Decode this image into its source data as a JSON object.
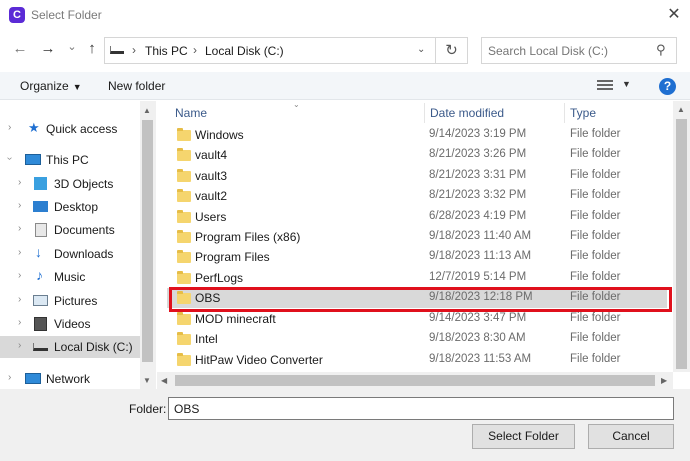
{
  "window": {
    "title": "Select Folder",
    "app_icon_letter": "C"
  },
  "nav": {
    "back": "←",
    "forward": "→",
    "recent": "⌄",
    "up": "↑",
    "breadcrumbs": [
      "This PC",
      "Local Disk (C:)"
    ],
    "separator": "›",
    "refresh": "↻"
  },
  "search": {
    "placeholder": "Search Local Disk (C:)"
  },
  "toolbar": {
    "organize": "Organize",
    "new_folder": "New folder",
    "help": "?"
  },
  "sidebar": {
    "items": [
      {
        "label": "Quick access",
        "icon": "star-icon"
      },
      {
        "label": "This PC",
        "icon": "pc-icon"
      },
      {
        "label": "3D Objects",
        "icon": "cube-icon"
      },
      {
        "label": "Desktop",
        "icon": "desktop-icon"
      },
      {
        "label": "Documents",
        "icon": "documents-icon"
      },
      {
        "label": "Downloads",
        "icon": "download-icon"
      },
      {
        "label": "Music",
        "icon": "music-icon"
      },
      {
        "label": "Pictures",
        "icon": "pictures-icon"
      },
      {
        "label": "Videos",
        "icon": "videos-icon"
      },
      {
        "label": "Local Disk (C:)",
        "icon": "drive-icon"
      },
      {
        "label": "Network",
        "icon": "network-icon"
      }
    ],
    "selected": "Local Disk (C:)"
  },
  "columns": {
    "name": "Name",
    "date": "Date modified",
    "type": "Type"
  },
  "files": [
    {
      "name": "Windows",
      "date": "9/14/2023 3:19 PM",
      "type": "File folder"
    },
    {
      "name": "vault4",
      "date": "8/21/2023 3:26 PM",
      "type": "File folder"
    },
    {
      "name": "vault3",
      "date": "8/21/2023 3:31 PM",
      "type": "File folder"
    },
    {
      "name": "vault2",
      "date": "8/21/2023 3:32 PM",
      "type": "File folder"
    },
    {
      "name": "Users",
      "date": "6/28/2023 4:19 PM",
      "type": "File folder"
    },
    {
      "name": "Program Files (x86)",
      "date": "9/18/2023 11:40 AM",
      "type": "File folder"
    },
    {
      "name": "Program Files",
      "date": "9/18/2023 11:13 AM",
      "type": "File folder"
    },
    {
      "name": "PerfLogs",
      "date": "12/7/2019 5:14 PM",
      "type": "File folder"
    },
    {
      "name": "OBS",
      "date": "9/18/2023 12:18 PM",
      "type": "File folder"
    },
    {
      "name": "MOD minecraft",
      "date": "9/14/2023 3:47 PM",
      "type": "File folder"
    },
    {
      "name": "Intel",
      "date": "9/18/2023 8:30 AM",
      "type": "File folder"
    },
    {
      "name": "HitPaw Video Converter",
      "date": "9/18/2023 11:53 AM",
      "type": "File folder"
    }
  ],
  "selected_file": "OBS",
  "folder_field": {
    "label": "Folder:",
    "value": "OBS"
  },
  "buttons": {
    "select": "Select Folder",
    "cancel": "Cancel"
  },
  "colors": {
    "highlight": "#e0101c",
    "selection": "#d9d9d9",
    "folder": "#f5d56e",
    "help": "#1f6fd1"
  }
}
